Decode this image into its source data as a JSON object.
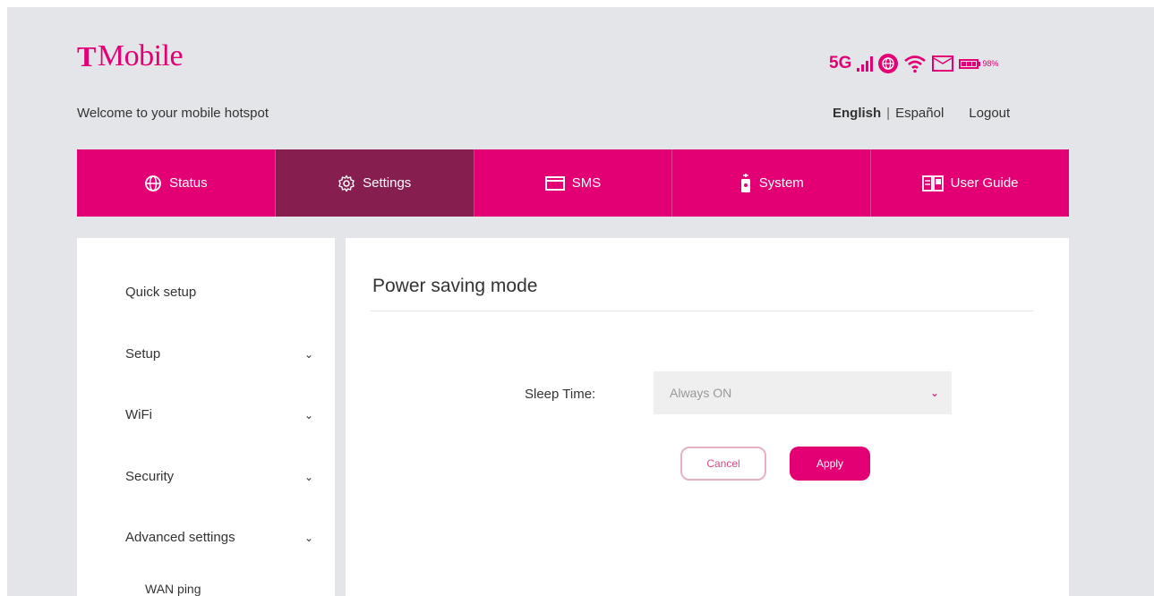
{
  "brand": {
    "logo_text": "Mobile",
    "logo_mark": "T",
    "color": "#e20074"
  },
  "header": {
    "welcome": "Welcome to your mobile hotspot",
    "network_type": "5G",
    "battery_percent": "98%",
    "icons": [
      "signal-icon",
      "globe-icon",
      "wifi-icon",
      "mail-icon",
      "battery-icon"
    ]
  },
  "language": {
    "english": "English",
    "separator": "|",
    "spanish": "Español",
    "logout": "Logout"
  },
  "nav": {
    "items": [
      {
        "label": "Status",
        "icon": "globe-icon"
      },
      {
        "label": "Settings",
        "icon": "gear-icon",
        "active": true
      },
      {
        "label": "SMS",
        "icon": "mail-icon"
      },
      {
        "label": "System",
        "icon": "device-icon"
      },
      {
        "label": "User Guide",
        "icon": "book-icon"
      }
    ],
    "active_color": "#861e4f"
  },
  "sidebar": {
    "items": [
      {
        "label": "Quick setup",
        "expandable": false
      },
      {
        "label": "Setup",
        "expandable": true
      },
      {
        "label": "WiFi",
        "expandable": true
      },
      {
        "label": "Security",
        "expandable": true
      },
      {
        "label": "Advanced settings",
        "expandable": true
      }
    ],
    "sub_items": [
      {
        "label": "WAN ping"
      }
    ]
  },
  "main": {
    "title": "Power saving mode",
    "sleep_label": "Sleep Time:",
    "sleep_value": "Always ON",
    "cancel_label": "Cancel",
    "apply_label": "Apply"
  }
}
